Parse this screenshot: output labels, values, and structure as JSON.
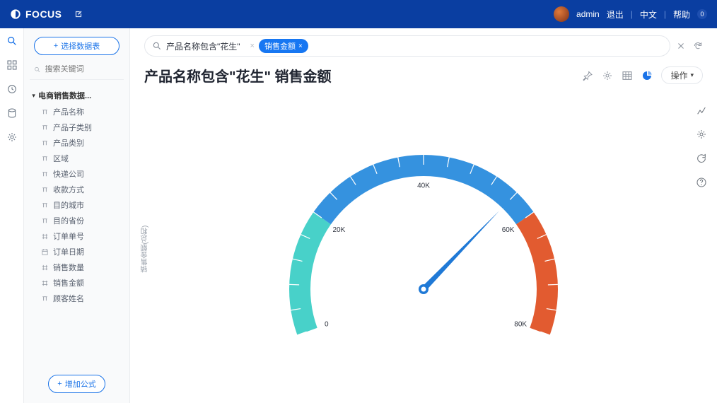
{
  "brand": "FOCUS",
  "topbar": {
    "user": "admin",
    "logout": "退出",
    "lang": "中文",
    "help": "帮助",
    "badge": "0"
  },
  "left": {
    "select_source": "选择数据表",
    "search_placeholder": "搜索关键词",
    "root": "电商销售数据...",
    "items": [
      {
        "label": "产品名称",
        "icon": "text"
      },
      {
        "label": "产品子类别",
        "icon": "text"
      },
      {
        "label": "产品类别",
        "icon": "text"
      },
      {
        "label": "区域",
        "icon": "text"
      },
      {
        "label": "快递公司",
        "icon": "text"
      },
      {
        "label": "收款方式",
        "icon": "text"
      },
      {
        "label": "目的城市",
        "icon": "text"
      },
      {
        "label": "目的省份",
        "icon": "text"
      },
      {
        "label": "订单单号",
        "icon": "num"
      },
      {
        "label": "订单日期",
        "icon": "date"
      },
      {
        "label": "销售数量",
        "icon": "num"
      },
      {
        "label": "销售金额",
        "icon": "num"
      },
      {
        "label": "顾客姓名",
        "icon": "text"
      }
    ],
    "add_formula": "增加公式"
  },
  "query": {
    "filter_text": "产品名称包含\"花生\"",
    "chip": "销售金额"
  },
  "page_title": "产品名称包含\"花生\" 销售金额",
  "actions_button": "操作",
  "ylabel": "销售金额(总和)",
  "chart_data": {
    "type": "gauge",
    "value": 56000,
    "min": 0,
    "max": 80000,
    "ticks": [
      {
        "v": 0,
        "label": "0"
      },
      {
        "v": 20000,
        "label": "20K"
      },
      {
        "v": 40000,
        "label": "40K"
      },
      {
        "v": 60000,
        "label": "60K"
      },
      {
        "v": 80000,
        "label": "80K"
      }
    ],
    "segments": [
      {
        "from": 0,
        "to": 20000,
        "color": "#48d1c9"
      },
      {
        "from": 20000,
        "to": 60000,
        "color": "#3592df"
      },
      {
        "from": 60000,
        "to": 80000,
        "color": "#e25b30"
      }
    ],
    "title": "",
    "ylabel": "销售金额(总和)"
  }
}
